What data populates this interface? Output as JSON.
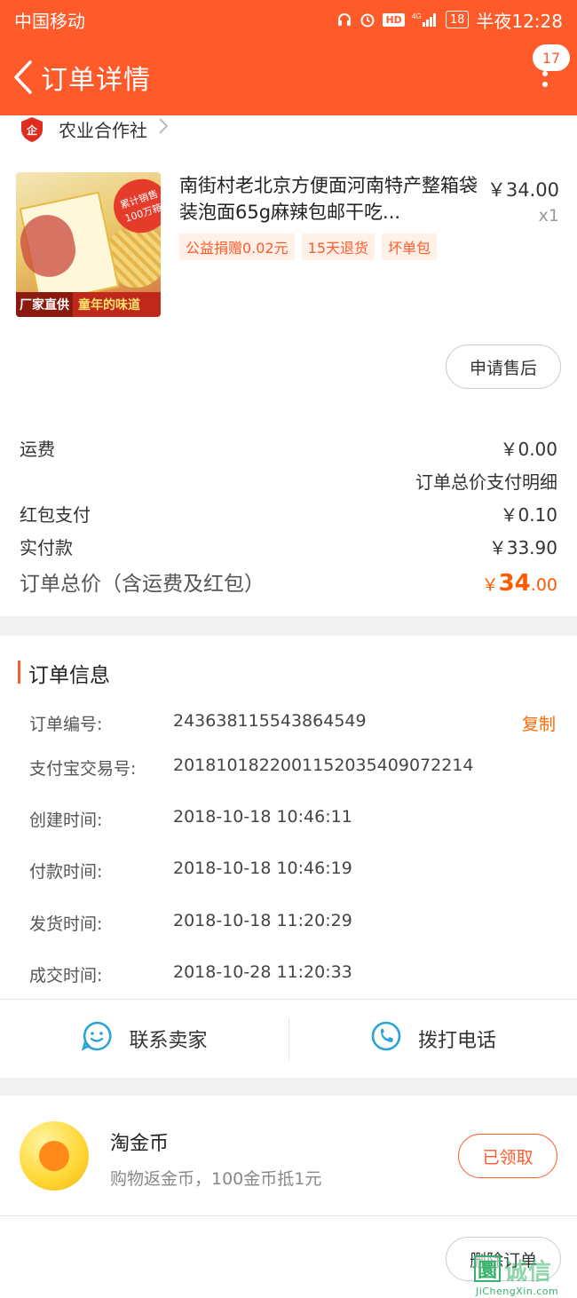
{
  "status_bar": {
    "carrier": "中国移动",
    "network": "4G",
    "battery": "18",
    "time": "半夜12:28"
  },
  "header": {
    "title": "订单详情",
    "badge_count": "17"
  },
  "shop": {
    "name": "农业合作社"
  },
  "product": {
    "title": "南街村老北京方便面河南特产整箱袋装泡面65g麻辣包邮干吃...",
    "price": "￥34.00",
    "quantity": "x1",
    "tags": [
      "公益捐赠0.02元",
      "15天退货",
      "坏单包"
    ],
    "image_text": {
      "badge": "累计销售100万箱",
      "left": "厂家直供",
      "right": "童年的味道"
    }
  },
  "after_sale_button": "申请售后",
  "summary": {
    "shipping_label": "运费",
    "shipping_value": "￥0.00",
    "detail_link": "订单总价支付明细",
    "redpacket_label": "红包支付",
    "redpacket_value": "￥0.10",
    "paid_label": "实付款",
    "paid_value": "￥33.90",
    "total_label": "订单总价（含运费及红包）",
    "total_currency": "￥",
    "total_int": "34",
    "total_dec": ".00"
  },
  "order_info": {
    "title": "订单信息",
    "copy_label": "复制",
    "rows": [
      {
        "label": "订单编号:",
        "value": "243638115543864549"
      },
      {
        "label": "支付宝交易号:",
        "value": "2018101822001152035409072214"
      },
      {
        "label": "创建时间:",
        "value": "2018-10-18 10:46:11"
      },
      {
        "label": "付款时间:",
        "value": "2018-10-18 10:46:19"
      },
      {
        "label": "发货时间:",
        "value": "2018-10-18 11:20:29"
      },
      {
        "label": "成交时间:",
        "value": "2018-10-28 11:20:33"
      }
    ]
  },
  "contact": {
    "seller_label": "联系卖家",
    "call_label": "拨打电话"
  },
  "coins": {
    "title": "淘金币",
    "subtitle": "购物返金币，100金币抵1元",
    "button": "已领取"
  },
  "delete_button": "删除订单",
  "watermark": {
    "mark": "圜",
    "text": "诚信",
    "url": "JiChengXin.com"
  },
  "colors": {
    "brand": "#ff5a2a",
    "price_accent": "#ff5a00",
    "band": "#f2f2f2",
    "icon_blue": "#2aa3d9"
  }
}
